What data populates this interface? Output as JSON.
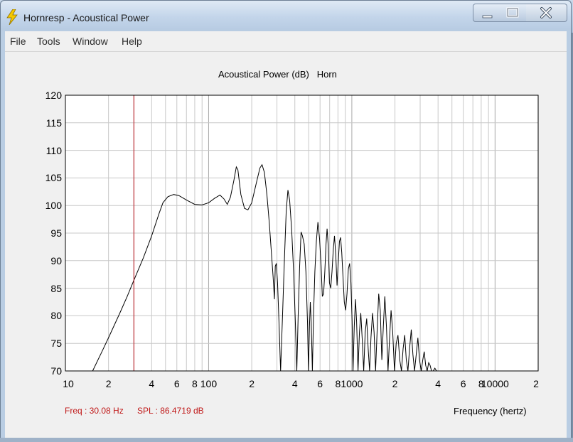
{
  "window": {
    "title": "Hornresp - Acoustical Power",
    "controls": {
      "minimize": "minimize",
      "maximize": "maximize",
      "close": "close"
    }
  },
  "menu": {
    "items": [
      {
        "label": "File"
      },
      {
        "label": "Tools"
      },
      {
        "label": "Window"
      },
      {
        "label": "Help"
      }
    ]
  },
  "cursor_readout": {
    "freq": "Freq : 30.08 Hz",
    "spl": "SPL : 86.4719 dB"
  },
  "colors": {
    "curve": "#000000",
    "marker": "#c0141c",
    "readout": "#c01818",
    "grid": "#c8c8c8",
    "grid_major": "#a8a8a8"
  },
  "chart_data": {
    "type": "line",
    "title": "Acoustical Power (dB)   Horn",
    "xlabel": "Frequency (hertz)",
    "ylabel": "",
    "x_scale": "log",
    "xlim": [
      10,
      20000
    ],
    "ylim": [
      70,
      120
    ],
    "grid": true,
    "y_ticks": [
      "120",
      "115",
      "110",
      "105",
      "100",
      "95",
      "90",
      "85",
      "80",
      "75",
      "70"
    ],
    "x_ticks": [
      {
        "value": 10,
        "label": "10"
      },
      {
        "value": 20,
        "label": "2"
      },
      {
        "value": 40,
        "label": "4"
      },
      {
        "value": 60,
        "label": "6"
      },
      {
        "value": 80,
        "label": "8"
      },
      {
        "value": 100,
        "label": "100"
      },
      {
        "value": 200,
        "label": "2"
      },
      {
        "value": 400,
        "label": "4"
      },
      {
        "value": 600,
        "label": "6"
      },
      {
        "value": 800,
        "label": "8"
      },
      {
        "value": 1000,
        "label": "1000"
      },
      {
        "value": 2000,
        "label": "2"
      },
      {
        "value": 4000,
        "label": "4"
      },
      {
        "value": 6000,
        "label": "6"
      },
      {
        "value": 8000,
        "label": "8"
      },
      {
        "value": 10000,
        "label": "10000"
      },
      {
        "value": 20000,
        "label": "2"
      }
    ],
    "marker_x": 30.08,
    "series": [
      {
        "values": [
          [
            15.5,
            70
          ],
          [
            18,
            73.5
          ],
          [
            20,
            76
          ],
          [
            24,
            80.5
          ],
          [
            27,
            83.5
          ],
          [
            30.08,
            86.47
          ],
          [
            35,
            90.5
          ],
          [
            40,
            94.5
          ],
          [
            45,
            98.5
          ],
          [
            48,
            100.5
          ],
          [
            52,
            101.6
          ],
          [
            57,
            102
          ],
          [
            62,
            101.8
          ],
          [
            70,
            101
          ],
          [
            80,
            100.2
          ],
          [
            90,
            100.1
          ],
          [
            100,
            100.5
          ],
          [
            110,
            101.3
          ],
          [
            120,
            101.9
          ],
          [
            128,
            101.2
          ],
          [
            135,
            100.2
          ],
          [
            142,
            101.5
          ],
          [
            150,
            104.5
          ],
          [
            156,
            107
          ],
          [
            160,
            106.5
          ],
          [
            168,
            102
          ],
          [
            178,
            99.5
          ],
          [
            188,
            99.2
          ],
          [
            200,
            100.5
          ],
          [
            215,
            104
          ],
          [
            228,
            106.8
          ],
          [
            236,
            107.4
          ],
          [
            245,
            106
          ],
          [
            255,
            102
          ],
          [
            265,
            97
          ],
          [
            275,
            91
          ],
          [
            282,
            87
          ],
          [
            288,
            83
          ],
          [
            292,
            89
          ],
          [
            297,
            89.5
          ],
          [
            303,
            86
          ],
          [
            310,
            79
          ],
          [
            318,
            70
          ],
          [
            328,
            80
          ],
          [
            338,
            90
          ],
          [
            348,
            99
          ],
          [
            358,
            102.8
          ],
          [
            368,
            101
          ],
          [
            380,
            95.5
          ],
          [
            392,
            88
          ],
          [
            403,
            79
          ],
          [
            413,
            70
          ],
          [
            422,
            80
          ],
          [
            432,
            89
          ],
          [
            442,
            95.2
          ],
          [
            452,
            94.5
          ],
          [
            465,
            93
          ],
          [
            478,
            88
          ],
          [
            490,
            79
          ],
          [
            498,
            70
          ],
          [
            506,
            78
          ],
          [
            513,
            82.5
          ],
          [
            520,
            79
          ],
          [
            530,
            70
          ],
          [
            540,
            80
          ],
          [
            552,
            88
          ],
          [
            565,
            93.5
          ],
          [
            580,
            97
          ],
          [
            595,
            94
          ],
          [
            610,
            89
          ],
          [
            622,
            83.5
          ],
          [
            635,
            84
          ],
          [
            648,
            88
          ],
          [
            660,
            93
          ],
          [
            672,
            95.8
          ],
          [
            685,
            92.5
          ],
          [
            698,
            86
          ],
          [
            712,
            85
          ],
          [
            727,
            88
          ],
          [
            742,
            92
          ],
          [
            757,
            94.5
          ],
          [
            772,
            91
          ],
          [
            788,
            85.5
          ],
          [
            805,
            90
          ],
          [
            820,
            93.5
          ],
          [
            835,
            94.2
          ],
          [
            850,
            91.5
          ],
          [
            868,
            87
          ],
          [
            886,
            82.5
          ],
          [
            905,
            81
          ],
          [
            925,
            84
          ],
          [
            945,
            88.5
          ],
          [
            965,
            89.5
          ],
          [
            985,
            86
          ],
          [
            1005,
            79
          ],
          [
            1020,
            70
          ],
          [
            1040,
            78
          ],
          [
            1060,
            83
          ],
          [
            1080,
            79
          ],
          [
            1105,
            70
          ],
          [
            1130,
            77
          ],
          [
            1155,
            80.5
          ],
          [
            1180,
            76
          ],
          [
            1210,
            70
          ],
          [
            1240,
            77
          ],
          [
            1270,
            79.5
          ],
          [
            1300,
            74
          ],
          [
            1330,
            70
          ],
          [
            1360,
            76
          ],
          [
            1395,
            80.5
          ],
          [
            1430,
            77
          ],
          [
            1465,
            70
          ],
          [
            1500,
            77
          ],
          [
            1540,
            84
          ],
          [
            1580,
            81
          ],
          [
            1620,
            72
          ],
          [
            1660,
            78
          ],
          [
            1700,
            83.5
          ],
          [
            1745,
            78
          ],
          [
            1790,
            70
          ],
          [
            1835,
            76
          ],
          [
            1880,
            81
          ],
          [
            1930,
            77
          ],
          [
            1985,
            70
          ],
          [
            2040,
            75
          ],
          [
            2100,
            76.5
          ],
          [
            2160,
            72
          ],
          [
            2220,
            70
          ],
          [
            2280,
            74
          ],
          [
            2340,
            76.5
          ],
          [
            2400,
            72
          ],
          [
            2465,
            70
          ],
          [
            2530,
            74
          ],
          [
            2600,
            77.5
          ],
          [
            2670,
            73
          ],
          [
            2740,
            70
          ],
          [
            2815,
            73
          ],
          [
            2890,
            76
          ],
          [
            2970,
            72
          ],
          [
            3050,
            70
          ],
          [
            3130,
            72
          ],
          [
            3200,
            73.5
          ],
          [
            3280,
            71
          ],
          [
            3360,
            70
          ],
          [
            3440,
            71.5
          ],
          [
            3520,
            71
          ],
          [
            3600,
            70
          ],
          [
            3700,
            70
          ],
          [
            3800,
            70.5
          ],
          [
            3900,
            70
          ]
        ]
      }
    ]
  }
}
